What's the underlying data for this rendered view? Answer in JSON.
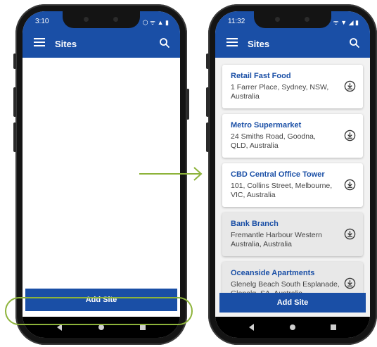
{
  "left_phone": {
    "status_time": "3:10",
    "status_icons": "⬡ ᯤ ▲ ▮",
    "appbar_title": "Sites",
    "add_button_label": "Add Site"
  },
  "right_phone": {
    "status_time": "11:32",
    "status_icons": "ᯤ ▼ ◢ ▮",
    "appbar_title": "Sites",
    "add_button_label": "Add Site",
    "sites": [
      {
        "name": "Retail Fast Food",
        "address": "1 Farrer Place, Sydney, NSW, Australia"
      },
      {
        "name": "Metro Supermarket",
        "address": "24 Smiths Road, Goodna, QLD, Australia"
      },
      {
        "name": "CBD Central Office Tower",
        "address": "101, Collins Street, Melbourne, VIC, Australia"
      },
      {
        "name": "Bank Branch",
        "address": "Fremantle Harbour Western Australia, Australia"
      },
      {
        "name": "Oceanside Apartments",
        "address": "Glenelg Beach South Esplanade, Glenelg, SA, Australia"
      }
    ]
  },
  "colors": {
    "brand_blue": "#1a4fa6",
    "highlight_green": "#8db33a"
  },
  "icons": [
    "menu-icon",
    "search-icon",
    "download-icon",
    "back-icon",
    "home-icon",
    "recent-apps-icon",
    "arrow-right-icon"
  ]
}
